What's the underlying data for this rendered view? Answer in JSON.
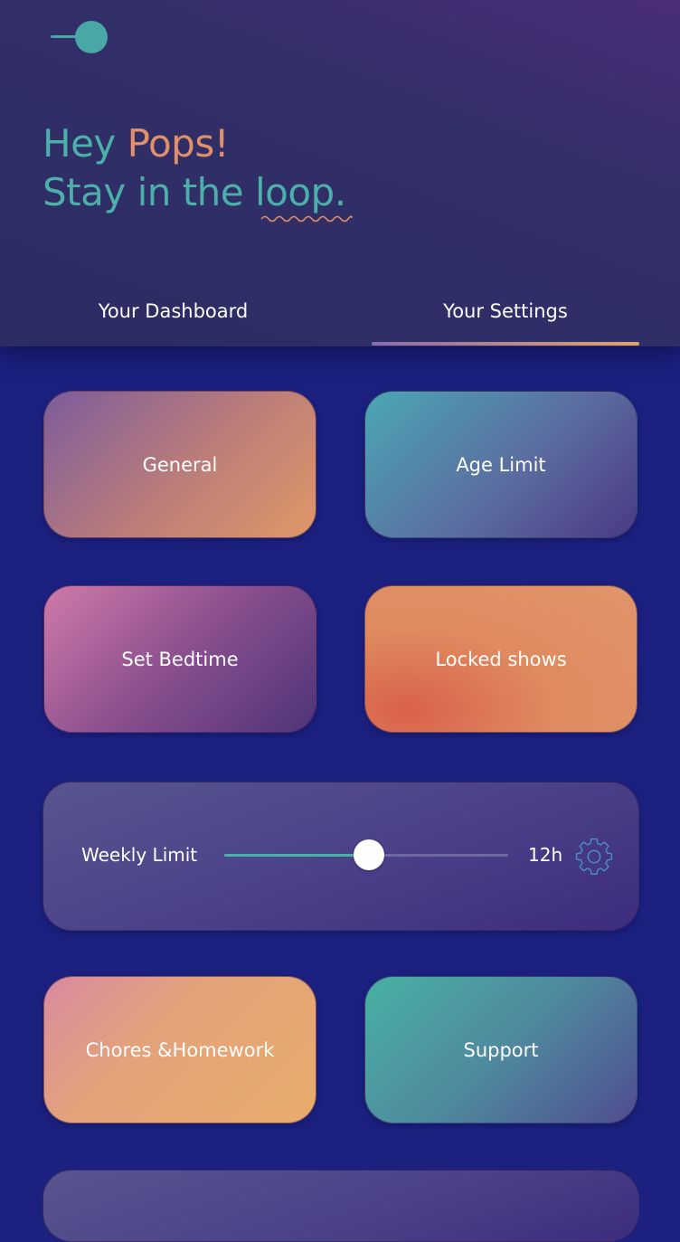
{
  "header": {
    "greeting_hey": "Hey",
    "greeting_name": "Pops!",
    "greeting_line2_prefix": "Stay in the",
    "greeting_line2_word": "loop."
  },
  "tabs": [
    {
      "label": "Your Dashboard",
      "active": false
    },
    {
      "label": "Your Settings",
      "active": true
    }
  ],
  "settings": {
    "general": "General",
    "age_limit": "Age Limit",
    "set_bedtime": "Set Bedtime",
    "locked_shows": "Locked shows",
    "weekly_limit": {
      "label": "Weekly Limit",
      "value_text": "12h",
      "slider_fraction": 0.51
    },
    "chores": "Chores &Homework",
    "support": "Support"
  },
  "icons": {
    "logo": "toggle-logo-icon",
    "settings": "gear-icon"
  },
  "colors": {
    "teal": "#4bb0a9",
    "orange": "#e0906a",
    "background": "#1c2180"
  }
}
